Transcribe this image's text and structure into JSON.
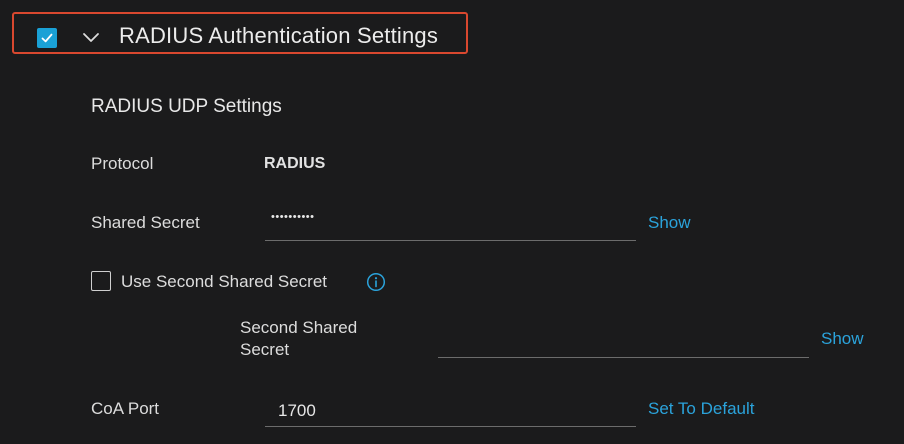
{
  "header": {
    "title": "RADIUS Authentication Settings",
    "checked": true
  },
  "udp": {
    "title": "RADIUS UDP Settings",
    "protocol": {
      "label": "Protocol",
      "value": "RADIUS"
    },
    "shared_secret": {
      "label": "Shared Secret",
      "value": "••••••••••",
      "action": "Show"
    },
    "use_second_secret": {
      "label": "Use Second Shared Secret",
      "checked": false
    },
    "second_secret": {
      "label_line1": "Second Shared",
      "label_line2": "Secret",
      "value": "",
      "action": "Show"
    },
    "coa_port": {
      "label": "CoA Port",
      "value": "1700",
      "action": "Set To Default"
    }
  },
  "colors": {
    "background": "#1b1b1c",
    "accent": "#1aa1d6",
    "link": "#2ba3db",
    "highlight_border": "#d9482f"
  },
  "icons": {
    "header_checkbox": "checkmark-icon",
    "collapse": "chevron-down-icon",
    "info": "info-icon"
  }
}
